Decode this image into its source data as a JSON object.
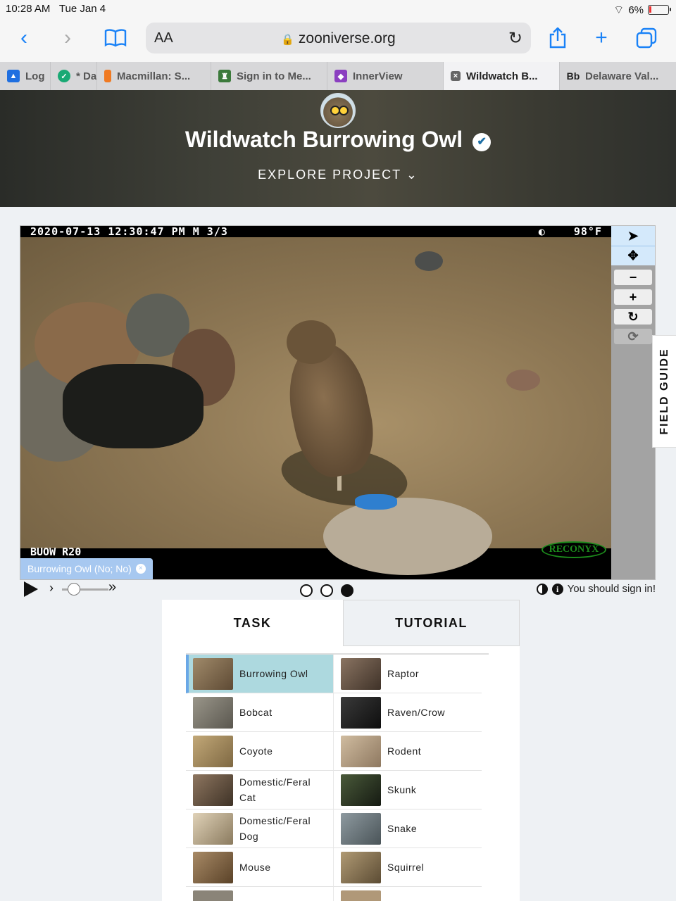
{
  "status": {
    "time": "10:28 AM",
    "date": "Tue Jan 4",
    "battery": "6%"
  },
  "toolbar": {
    "text_size": "AA",
    "url": "zooniverse.org"
  },
  "tabs": [
    {
      "label": "Log",
      "color": "#1f6fe0"
    },
    {
      "label": "* Da",
      "color": "#19a974"
    },
    {
      "label": "Macmillan: S...",
      "color": "#f07a22"
    },
    {
      "label": "Sign in to Me...",
      "color": "#3b7a3b"
    },
    {
      "label": "InnerView",
      "color": "#8b3fc0"
    },
    {
      "label": "Wildwatch B...",
      "color": "#666666"
    },
    {
      "label": "Delaware Val...",
      "color": "#444444"
    }
  ],
  "project": {
    "title": "Wildwatch Burrowing Owl",
    "explore": "EXPLORE PROJECT"
  },
  "photo": {
    "stamp_left": "2020-07-13 12:30:47 PM  M 3/3",
    "stamp_right": "98°F",
    "camera_id": "BUOW R20",
    "brand": "RECONYX",
    "mark_tag": "Burrowing Owl (No; No)"
  },
  "field_guide": "FIELD GUIDE",
  "controls": {
    "sign_in": "You should sign in!",
    "frames": 3,
    "current_frame": 3
  },
  "task_panel": {
    "task_tab": "TASK",
    "tutorial_tab": "TUTORIAL",
    "choices": [
      {
        "label": "Burrowing Owl",
        "selected": true,
        "color": "#7a6247"
      },
      {
        "label": "Raptor",
        "color": "#6b5a4a"
      },
      {
        "label": "Bobcat",
        "color": "#7d7a72"
      },
      {
        "label": "Raven/Crow",
        "color": "#1c1c1c"
      },
      {
        "label": "Coyote",
        "color": "#a08a60"
      },
      {
        "label": "Rodent",
        "color": "#b39c80"
      },
      {
        "label": "Domestic/Feral Cat",
        "color": "#6e5a45"
      },
      {
        "label": "Skunk",
        "color": "#2f3a2a"
      },
      {
        "label": "Domestic/Feral Dog",
        "color": "#c9b89a"
      },
      {
        "label": "Snake",
        "color": "#6f7a80"
      },
      {
        "label": "Mouse",
        "color": "#8a6a48"
      },
      {
        "label": "Squirrel",
        "color": "#8c7a5a"
      },
      {
        "label": "",
        "color": "#8a8478"
      },
      {
        "label": "",
        "color": "#b09878"
      }
    ]
  }
}
